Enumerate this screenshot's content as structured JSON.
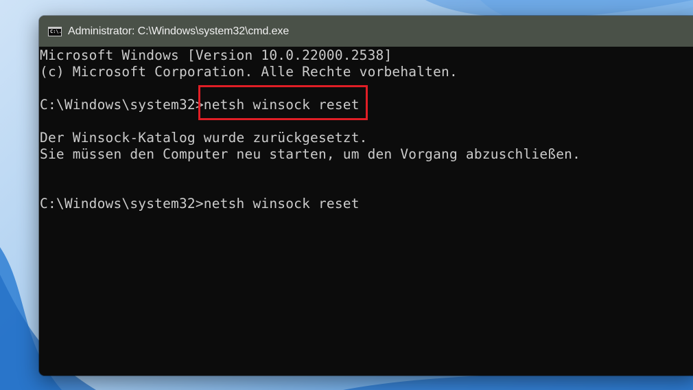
{
  "window": {
    "title": "Administrator: C:\\Windows\\system32\\cmd.exe",
    "icon_text": "C:\\."
  },
  "console": {
    "lines": [
      "Microsoft Windows [Version 10.0.22000.2538]",
      "(c) Microsoft Corporation. Alle Rechte vorbehalten.",
      "",
      "C:\\Windows\\system32>netsh winsock reset",
      "",
      "Der Winsock-Katalog wurde zurückgesetzt.",
      "Sie müssen den Computer neu starten, um den Vorgang abzuschließen.",
      "",
      "",
      "C:\\Windows\\system32>netsh winsock reset"
    ]
  },
  "annotation": {
    "highlight_color": "#e01e26"
  },
  "colors": {
    "console_bg": "#0c0c0c",
    "console_text": "#cccccc",
    "titlebar_bg": "#4a5148"
  }
}
